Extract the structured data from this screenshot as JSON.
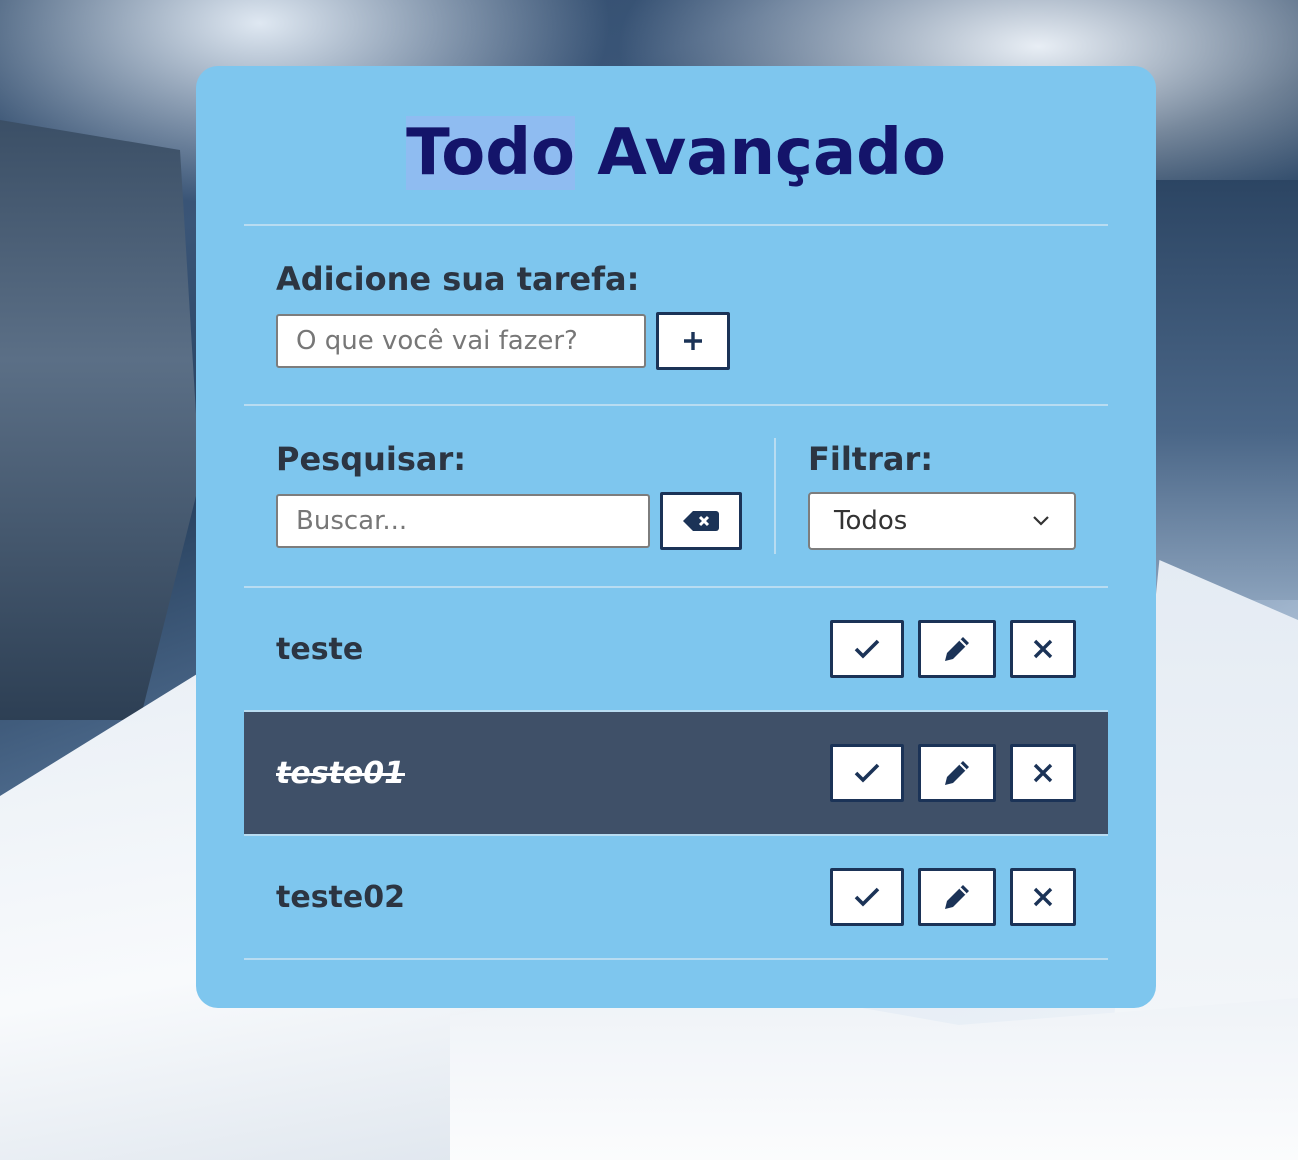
{
  "app": {
    "title_part1": "Todo",
    "title_part2": " Avançado"
  },
  "add": {
    "label": "Adicione sua tarefa:",
    "placeholder": "O que você vai fazer?",
    "button_label": "+"
  },
  "search": {
    "label": "Pesquisar:",
    "placeholder": "Buscar..."
  },
  "filter": {
    "label": "Filtrar:",
    "selected": "Todos"
  },
  "todos": [
    {
      "text": "teste",
      "done": false
    },
    {
      "text": "teste01",
      "done": true
    },
    {
      "text": "teste02",
      "done": false
    }
  ],
  "icons": [
    "plus-icon",
    "backspace-icon",
    "chevron-down-icon",
    "check-icon",
    "pencil-icon",
    "close-icon"
  ],
  "colors": {
    "card": "#7ec6ee",
    "title": "#14146a",
    "done_row": "#3f5068",
    "button_border": "#1b3357"
  }
}
